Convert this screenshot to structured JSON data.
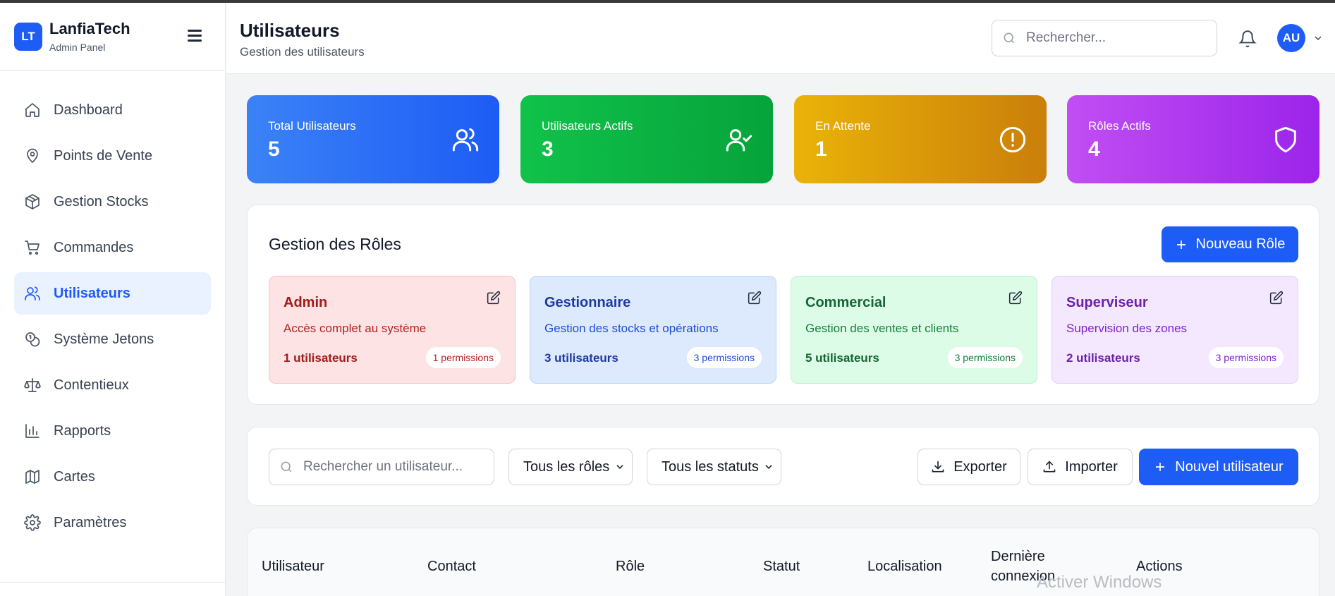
{
  "brand": {
    "logo": "LT",
    "name": "LanfiaTech",
    "subtitle": "Admin Panel"
  },
  "nav": [
    {
      "label": "Dashboard",
      "icon": "home-icon"
    },
    {
      "label": "Points de Vente",
      "icon": "map-pin-icon"
    },
    {
      "label": "Gestion Stocks",
      "icon": "package-icon"
    },
    {
      "label": "Commandes",
      "icon": "cart-icon"
    },
    {
      "label": "Utilisateurs",
      "icon": "users-icon",
      "active": true
    },
    {
      "label": "Système Jetons",
      "icon": "coins-icon"
    },
    {
      "label": "Contentieux",
      "icon": "scale-icon"
    },
    {
      "label": "Rapports",
      "icon": "bar-chart-icon"
    },
    {
      "label": "Cartes",
      "icon": "map-icon"
    },
    {
      "label": "Paramètres",
      "icon": "gear-icon"
    }
  ],
  "header": {
    "title": "Utilisateurs",
    "subtitle": "Gestion des utilisateurs",
    "search_placeholder": "Rechercher...",
    "avatar": "AU"
  },
  "stats": [
    {
      "label": "Total Utilisateurs",
      "value": "5",
      "icon": "users-icon",
      "color": "#1d5cf5"
    },
    {
      "label": "Utilisateurs Actifs",
      "value": "3",
      "icon": "user-check-icon",
      "color": "#06a33b"
    },
    {
      "label": "En Attente",
      "value": "1",
      "icon": "alert-circle-icon",
      "color": "#ca7f0a"
    },
    {
      "label": "Rôles Actifs",
      "value": "4",
      "icon": "shield-icon",
      "color": "#9b24ea"
    }
  ],
  "roles": {
    "title": "Gestion des Rôles",
    "new_button": "Nouveau Rôle",
    "items": [
      {
        "name": "Admin",
        "description": "Accès complet au système",
        "users": "1 utilisateurs",
        "permissions": "1 permissions"
      },
      {
        "name": "Gestionnaire",
        "description": "Gestion des stocks et opérations",
        "users": "3 utilisateurs",
        "permissions": "3 permissions"
      },
      {
        "name": "Commercial",
        "description": "Gestion des ventes et clients",
        "users": "5 utilisateurs",
        "permissions": "3 permissions"
      },
      {
        "name": "Superviseur",
        "description": "Supervision des zones",
        "users": "2 utilisateurs",
        "permissions": "3 permissions"
      }
    ]
  },
  "filters": {
    "search_placeholder": "Rechercher un utilisateur...",
    "role_select": "Tous les rôles",
    "status_select": "Tous les statuts",
    "export": "Exporter",
    "import": "Importer",
    "new_user": "Nouvel utilisateur"
  },
  "table": {
    "columns": [
      "Utilisateur",
      "Contact",
      "Rôle",
      "Statut",
      "Localisation",
      "Dernière connexion",
      "Actions"
    ]
  },
  "watermark": "Activer Windows"
}
